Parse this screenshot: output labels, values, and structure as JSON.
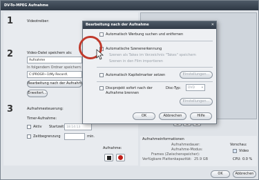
{
  "window": {
    "title": "DV-To-MPEG Aufnahme"
  },
  "left": {
    "step1": "1",
    "step2": "2",
    "step3": "3",
    "device_label": "Videotreiber:",
    "save_label": "Video-Datei speichern als:",
    "save_name": "Aufnahme",
    "folder_label": "In folgendem Ordner speichern:",
    "folder_path": "C:\\PROGR~1\\My Record\\",
    "edit_button": "Bearbeitung nach der Aufnahme",
    "browse_button": "Erweitert...",
    "rec_label": "Aufnahmesteuerung:",
    "timer_label": "Timer-Aufnahme:",
    "active_label": "Aktiv",
    "start_label": "Startzeit:",
    "start_time": "18:14:13",
    "limit_label": "Zeitbegrenzung",
    "minutes_label": "min.",
    "record_label": "Aufnahme:"
  },
  "right": {
    "info_title": "Aufnahmeinformationen",
    "duration_label": "Aufnahmedauer:",
    "mode_label": "Aufnahme-Modus:",
    "frames_label": "Frames (Zwischenspeicher):",
    "disk_label": "Verfügbare Plattenkapazität:",
    "disk_value": "25.9 GB",
    "preview_label": "Vorschau:",
    "video_label": "Video",
    "cpu_label": "CPU:",
    "cpu_value": "0.0 %"
  },
  "footer": {
    "ok": "OK",
    "cancel": "Abbrechen"
  },
  "dialog": {
    "title": "Bearbeitung nach der Aufnahme",
    "opt_ads": "Automatisch Werbung suchen und entfernen",
    "opt_scene": "Automatische Szenenerkennung",
    "opt_scene_sub1": "Szenen als Takes im Verzeichnis \"Takes\" speichern",
    "opt_scene_sub2": "Szenen in den Film importieren",
    "opt_chapter": "Automatisch Kapitelmarker setzen",
    "chapter_settings": "Einstellungen...",
    "opt_burn1": "Discprojekt sofort nach der",
    "opt_burn2": "Aufnahme brennen",
    "disc_type_label": "Disc-Typ:",
    "disc_type_value": "DVD",
    "burn_settings": "Einstellungen...",
    "ok": "OK",
    "cancel": "Abbrechen",
    "help": "Hilfe"
  }
}
